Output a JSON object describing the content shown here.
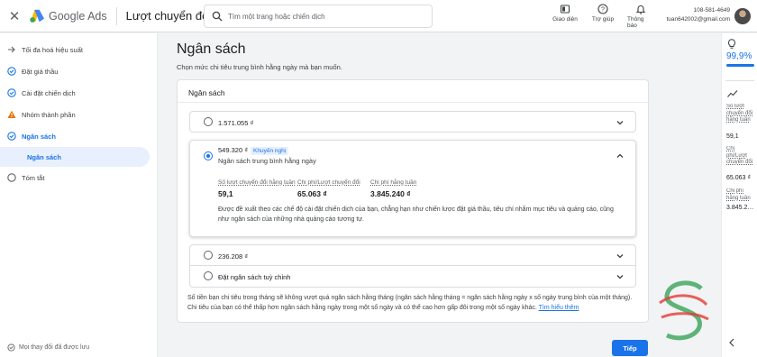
{
  "app": {
    "brand": "Google Ads",
    "page_title": "Lượt chuyển đổi"
  },
  "search": {
    "placeholder": "Tìm một trang hoặc chiến dịch"
  },
  "top_actions": [
    {
      "label": "Giao diện",
      "icon": "appearance-icon"
    },
    {
      "label": "Trợ giúp",
      "icon": "help-icon"
    },
    {
      "label": "Thông báo",
      "icon": "bell-icon"
    }
  ],
  "account": {
    "id": "108-581-4649",
    "email": "tuan642002@gmail.com"
  },
  "sidebar": {
    "items": [
      {
        "label": "Tối đa hoá hiệu suất",
        "status": "none"
      },
      {
        "label": "Đặt giá thầu",
        "status": "done"
      },
      {
        "label": "Cài đặt chiến dịch",
        "status": "done"
      },
      {
        "label": "Nhóm thành phần",
        "status": "warning"
      },
      {
        "label": "Ngân sách",
        "status": "active"
      },
      {
        "label": "Ngân sách",
        "status": "sub"
      },
      {
        "label": "Tóm tắt",
        "status": "empty"
      }
    ],
    "saved_text": "Mọi thay đổi đã được lưu"
  },
  "main": {
    "title": "Ngân sách",
    "subtitle": "Chọn mức chi tiêu trung bình hằng ngày mà bạn muốn.",
    "card_title": "Ngân sách",
    "options": [
      {
        "label": "1.571.055 ₫",
        "selected": false
      },
      {
        "label": "549.320 ₫",
        "badge": "Khuyến nghị",
        "desc": "Ngân sách trung bình hằng ngày",
        "selected": true,
        "metrics": [
          {
            "label": "Số lượt chuyển đổi hằng tuần",
            "value": "59,1"
          },
          {
            "label": "Chi phí/Lượt chuyển đổi",
            "value": "65.063 ₫"
          },
          {
            "label": "Chi phí hằng tuần",
            "value": "3.845.240 ₫"
          }
        ],
        "explanation": "Được đề xuất theo các chế độ cài đặt chiến dịch của bạn, chẳng hạn như chiến lược đặt giá thầu, tiêu chí nhắm mục tiêu và quảng cáo, cũng như ngân sách của những nhà quảng cáo tương tự."
      },
      {
        "label": "236.208 ₫",
        "selected": false
      },
      {
        "label": "Đặt ngân sách tuỳ chỉnh",
        "selected": false
      }
    ],
    "footnote": "Số tiền bạn chi tiêu trong tháng sẽ không vượt quá ngân sách hằng tháng (ngân sách hằng tháng = ngân sách hằng ngày x số ngày trung bình của một tháng). Chi tiêu của bạn có thể thấp hơn ngân sách hằng ngày trong một số ngày và có thể cao hơn gấp đôi trong một số ngày khác.",
    "learn_more": "Tìm hiểu thêm",
    "next_label": "Tiếp"
  },
  "right_panel": {
    "score": "99,9%",
    "score_fraction": 0.999,
    "metrics": [
      {
        "label": "Số lượt chuyển đổi hằng tuần",
        "value": "59,1"
      },
      {
        "label": "Chi phí/Lượt chuyển đổi",
        "value": "65.063 ₫"
      },
      {
        "label": "Chi phí hằng tuần",
        "value": "3.845.2…"
      }
    ]
  },
  "colors": {
    "accent": "#1a73e8",
    "warning": "#e37400",
    "watermark_green": "#2e9e4f",
    "watermark_red": "#e53935"
  }
}
